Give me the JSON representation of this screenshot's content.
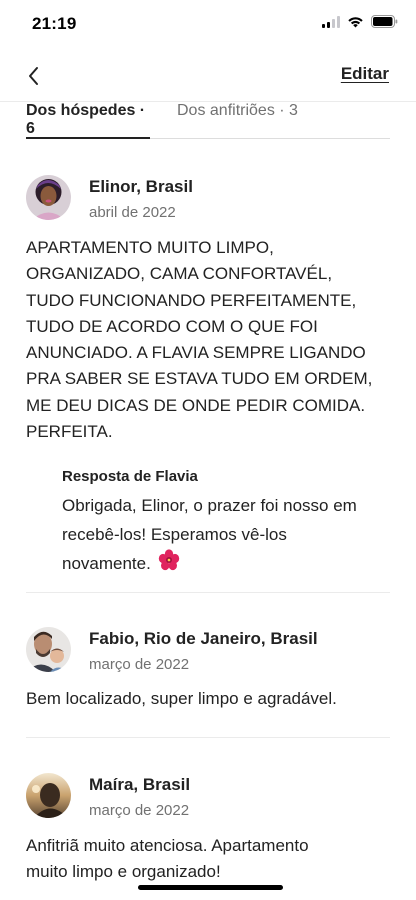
{
  "status_bar": {
    "time": "21:19"
  },
  "nav": {
    "edit_label": "Editar"
  },
  "tabs": [
    {
      "label": "Dos hóspedes · 6",
      "selected": true
    },
    {
      "label": "Dos anfitriões · 3",
      "selected": false
    }
  ],
  "reviews": [
    {
      "name": "Elinor, Brasil",
      "date": "abril de 2022",
      "text_lines": [
        "APARTAMENTO MUITO LIMPO,",
        "ORGANIZADO, CAMA CONFORTAVÉL,",
        "TUDO FUNCIONANDO PERFEITAMENTE,",
        "TUDO DE ACORDO COM O QUE FOI",
        "ANUNCIADO. A FLAVIA SEMPRE LIGANDO",
        "PRA SABER SE ESTAVA TUDO EM ORDEM,",
        "ME DEU DICAS DE ONDE PEDIR COMIDA.",
        "PERFEITA."
      ],
      "reply": {
        "title": "Resposta de Flavia",
        "text_lines": [
          "Obrigada, Elinor, o prazer foi nosso em",
          "recebê-los! Esperamos vê-los",
          "novamente."
        ]
      }
    },
    {
      "name": "Fabio, Rio de Janeiro, Brasil",
      "date": "março de 2022",
      "text_lines": [
        "Bem localizado, super limpo e agradável."
      ]
    },
    {
      "name": "Maíra, Brasil",
      "date": "março de 2022",
      "text_lines": [
        "Anfitriã muito atenciosa. Apartamento",
        "muito limpo e organizado!"
      ]
    }
  ],
  "icons": {
    "back": "chevron-left-icon",
    "flower": "hibiscus-emoji-icon",
    "signal": "cellular-signal-icon",
    "wifi": "wifi-icon",
    "battery": "battery-icon"
  },
  "colors": {
    "text_primary": "#222222",
    "text_secondary": "#717171",
    "divider": "#ebebeb",
    "flower": "#e0245e"
  }
}
